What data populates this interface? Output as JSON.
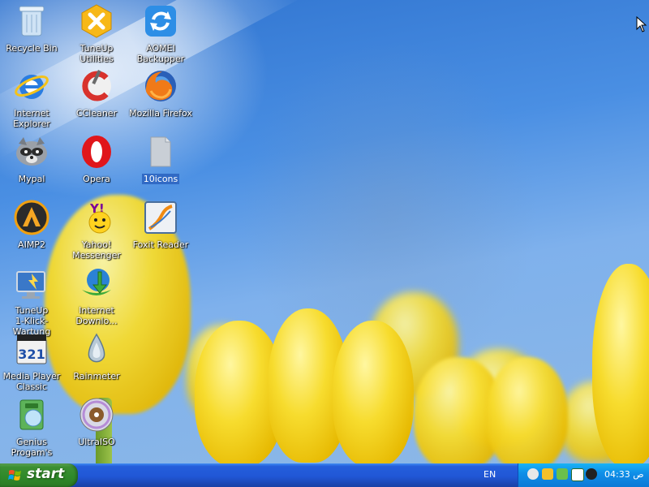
{
  "desktop": {
    "icons": [
      {
        "label": "Recycle Bin",
        "icon": "recycle-bin-icon"
      },
      {
        "label": "TuneUp Utilities",
        "icon": "tuneup-utilities-icon"
      },
      {
        "label": "AOMEI\nBackupper",
        "icon": "aomei-backupper-icon"
      },
      {
        "label": "Internet\nExplorer",
        "icon": "internet-explorer-icon"
      },
      {
        "label": "CCleaner",
        "icon": "ccleaner-icon"
      },
      {
        "label": "Mozilla Firefox",
        "icon": "firefox-icon"
      },
      {
        "label": "Mypal",
        "icon": "mypal-raccoon-icon"
      },
      {
        "label": "Opera",
        "icon": "opera-icon"
      },
      {
        "label": "10icons",
        "icon": "folder-icon",
        "selected": true
      },
      {
        "label": "AIMP2",
        "icon": "aimp2-icon"
      },
      {
        "label": "Yahoo!\nMessenger",
        "icon": "yahoo-messenger-icon"
      },
      {
        "label": "Foxit Reader",
        "icon": "foxit-reader-icon"
      },
      {
        "label": "TuneUp\n1-Klick-Wartung",
        "icon": "tuneup-1-klick-icon"
      },
      {
        "label": "Internet\nDownlo...",
        "icon": "internet-download-manager-icon"
      },
      {
        "label": "Media Player\nClassic",
        "icon": "media-player-classic-icon"
      },
      {
        "label": "Rainmeter",
        "icon": "rainmeter-icon"
      },
      {
        "label": "Genius\nProgam's",
        "icon": "genius-programs-icon"
      },
      {
        "label": "UltraISO",
        "icon": "ultraiso-icon"
      }
    ]
  },
  "taskbar": {
    "start_label": "start",
    "language": "EN",
    "clock": "04:33 ص",
    "tray_icons": [
      "messenger-tray-icon",
      "user-tray-icon",
      "network-tray-icon",
      "safely-remove-tray-icon",
      "volume-tray-icon"
    ]
  },
  "colors": {
    "taskbar_blue": "#245edb",
    "start_green": "#3c8f33",
    "tray_blue": "#0f8fe8",
    "selection_blue": "#316ac5"
  }
}
